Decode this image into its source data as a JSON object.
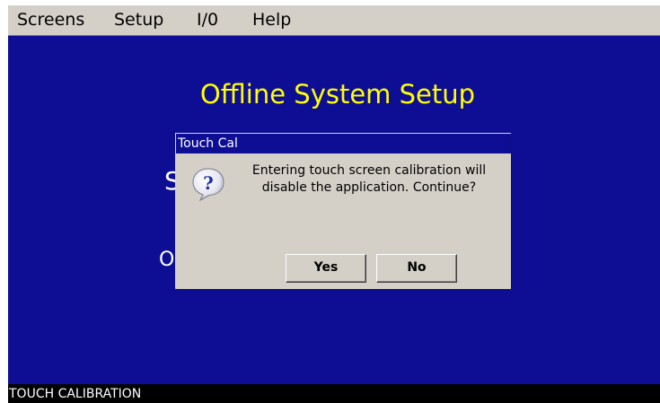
{
  "menu": {
    "items": [
      {
        "label": "Screens"
      },
      {
        "label": "Setup"
      },
      {
        "label": "I/0"
      },
      {
        "label": "Help"
      }
    ]
  },
  "main": {
    "title": "Offline System Setup",
    "background_fragments": [
      "S",
      "O"
    ]
  },
  "dialog": {
    "title": "Touch Cal",
    "icon": "question-icon",
    "message": "Entering touch screen calibration will disable the application. Continue?",
    "yes_label": "Yes",
    "no_label": "No"
  },
  "status": {
    "text": "TOUCH CALIBRATION"
  },
  "colors": {
    "background_blue": "#0e0e95",
    "title_yellow": "#ffff00",
    "chrome_gray": "#d4d0c8",
    "status_black": "#000000"
  }
}
